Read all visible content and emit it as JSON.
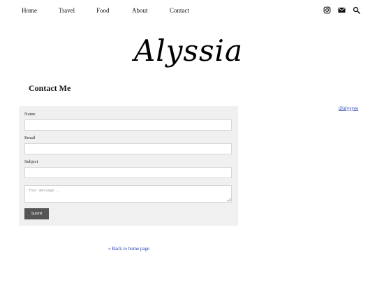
{
  "nav": {
    "items": [
      {
        "label": "Home"
      },
      {
        "label": "Travel"
      },
      {
        "label": "Food"
      },
      {
        "label": "About"
      },
      {
        "label": "Contact"
      }
    ],
    "social_icons": [
      "instagram-icon",
      "mail-icon",
      "search-icon"
    ]
  },
  "logo": {
    "text": "Alyssia"
  },
  "page": {
    "title": "Contact Me"
  },
  "sidebar": {
    "link": "@alyyyee"
  },
  "form": {
    "name_label": "Name",
    "name_value": "",
    "email_label": "Email",
    "email_value": "",
    "subject_label": "Subject",
    "subject_value": "",
    "message_placeholder": "Your message...",
    "submit_label": "Submit"
  },
  "footer": {
    "back_link": "« Back to home page"
  },
  "colors": {
    "link": "#223fb0",
    "form_bg": "#f0f0f0",
    "button": "#555555"
  }
}
